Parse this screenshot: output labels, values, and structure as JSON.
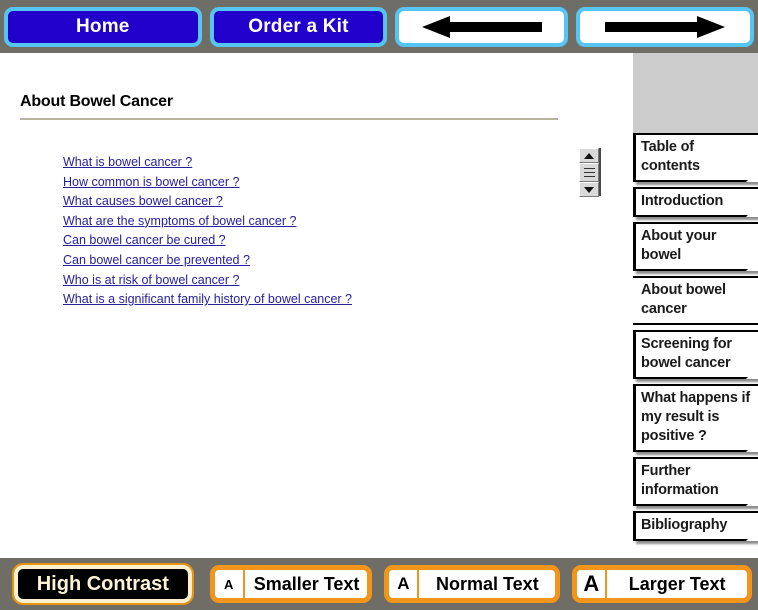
{
  "topnav": {
    "home_label": "Home",
    "order_label": "Order a Kit",
    "back_icon": "left-arrow-icon",
    "forward_icon": "right-arrow-icon"
  },
  "main": {
    "title": "About Bowel Cancer",
    "links": [
      "What is bowel cancer ?",
      "How common is bowel cancer ?",
      "What causes bowel cancer ?",
      "What are the symptoms of bowel cancer ?",
      "Can bowel cancer be cured ?",
      "Can bowel cancer be prevented ?",
      "Who is at risk of bowel cancer ?",
      "What is a significant family history of bowel cancer ?"
    ]
  },
  "scrollbar": {
    "up_icon": "scroll-up-arrow-icon",
    "down_icon": "scroll-down-arrow-icon",
    "thumb_icon": "scroll-thumb-grip-icon"
  },
  "sidebar": {
    "items": [
      {
        "label": "Table of contents",
        "active": false
      },
      {
        "label": "Introduction",
        "active": false
      },
      {
        "label": "About your bowel",
        "active": false
      },
      {
        "label": "About bowel cancer",
        "active": true
      },
      {
        "label": "Screening for bowel cancer",
        "active": false
      },
      {
        "label": "What happens if my result is positive ?",
        "active": false
      },
      {
        "label": "Further information",
        "active": false
      },
      {
        "label": "Bibliography",
        "active": false
      }
    ]
  },
  "bottombar": {
    "high_contrast_label": "High Contrast",
    "a_glyph": "A",
    "smaller_label": "Smaller Text",
    "normal_label": "Normal Text",
    "larger_label": "Larger Text"
  },
  "colors": {
    "chrome": "#6e6e66",
    "nav_blue": "#2200cc",
    "nav_border": "#57c5f2",
    "link": "#26219c",
    "accent_orange": "#f2951b",
    "grey_panel": "#cccccc"
  }
}
